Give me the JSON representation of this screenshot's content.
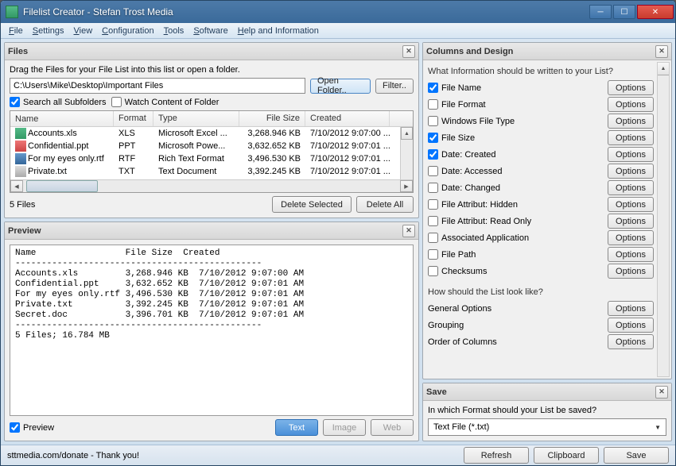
{
  "window": {
    "title": "Filelist Creator - Stefan Trost Media"
  },
  "menu": [
    "File",
    "Settings",
    "View",
    "Configuration",
    "Tools",
    "Software",
    "Help and Information"
  ],
  "files_panel": {
    "title": "Files",
    "hint": "Drag the Files for your File List into this list or open a folder.",
    "path": "C:\\Users\\Mike\\Desktop\\Important Files",
    "open_folder": "Open Folder..",
    "filter": "Filter..",
    "search_sub": "Search all Subfolders",
    "watch": "Watch Content of Folder",
    "cols": {
      "name": "Name",
      "format": "Format",
      "type": "Type",
      "size": "File Size",
      "created": "Created"
    },
    "rows": [
      {
        "icon": "xls",
        "name": "Accounts.xls",
        "fmt": "XLS",
        "type": "Microsoft Excel ...",
        "size": "3,268.946 KB",
        "date": "7/10/2012 9:07:00 ..."
      },
      {
        "icon": "ppt",
        "name": "Confidential.ppt",
        "fmt": "PPT",
        "type": "Microsoft Powe...",
        "size": "3,632.652 KB",
        "date": "7/10/2012 9:07:01 ..."
      },
      {
        "icon": "rtf",
        "name": "For my eyes only.rtf",
        "fmt": "RTF",
        "type": "Rich Text Format",
        "size": "3,496.530 KB",
        "date": "7/10/2012 9:07:01 ..."
      },
      {
        "icon": "txt",
        "name": "Private.txt",
        "fmt": "TXT",
        "type": "Text Document",
        "size": "3,392.245 KB",
        "date": "7/10/2012 9:07:01 ..."
      }
    ],
    "count": "5 Files",
    "delete_sel": "Delete Selected",
    "delete_all": "Delete All"
  },
  "preview_panel": {
    "title": "Preview",
    "text": "Name                 File Size  Created\n-----------------------------------------------\nAccounts.xls         3,268.946 KB  7/10/2012 9:07:00 AM\nConfidential.ppt     3,632.652 KB  7/10/2012 9:07:01 AM\nFor my eyes only.rtf 3,496.530 KB  7/10/2012 9:07:01 AM\nPrivate.txt          3,392.245 KB  7/10/2012 9:07:01 AM\nSecret.doc           3,396.701 KB  7/10/2012 9:07:01 AM\n-----------------------------------------------\n5 Files; 16.784 MB",
    "chk": "Preview",
    "btn_text": "Text",
    "btn_image": "Image",
    "btn_web": "Web"
  },
  "columns_panel": {
    "title": "Columns and Design",
    "q1": "What Information should be written to your List?",
    "opts": [
      {
        "label": "File Name",
        "checked": true
      },
      {
        "label": "File Format",
        "checked": false
      },
      {
        "label": "Windows File Type",
        "checked": false
      },
      {
        "label": "File Size",
        "checked": true
      },
      {
        "label": "Date: Created",
        "checked": true
      },
      {
        "label": "Date: Accessed",
        "checked": false
      },
      {
        "label": "Date: Changed",
        "checked": false
      },
      {
        "label": "File Attribut: Hidden",
        "checked": false
      },
      {
        "label": "File Attribut: Read Only",
        "checked": false
      },
      {
        "label": "Associated Application",
        "checked": false
      },
      {
        "label": "File Path",
        "checked": false
      },
      {
        "label": "Checksums",
        "checked": false
      }
    ],
    "options_btn": "Options",
    "q2": "How should the List look like?",
    "look": [
      "General Options",
      "Grouping",
      "Order of Columns"
    ]
  },
  "save_panel": {
    "title": "Save",
    "q": "In which Format should your List be saved?",
    "value": "Text File (*.txt)"
  },
  "status": {
    "text": "sttmedia.com/donate - Thank you!",
    "refresh": "Refresh",
    "clipboard": "Clipboard",
    "save": "Save"
  }
}
